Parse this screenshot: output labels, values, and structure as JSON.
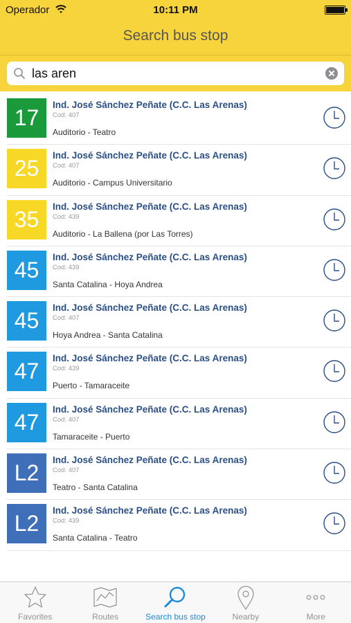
{
  "status_bar": {
    "carrier": "Operador",
    "time": "10:11 PM"
  },
  "nav": {
    "title": "Search bus stop"
  },
  "search": {
    "value": "las aren"
  },
  "colors": {
    "bar_yellow": "#f7d33c",
    "green": "#1a9a3a",
    "yellow": "#f7d826",
    "blue": "#1f9ae0",
    "dark_blue": "#3f6fb8",
    "active_tab": "#1a8bd9"
  },
  "results": [
    {
      "route": "17",
      "color": "#1a9a3a",
      "name": "Ind. José Sánchez Peñate (C.C. Las Arenas)",
      "code": "Cod: 407",
      "direction": "Auditorio - Teatro"
    },
    {
      "route": "25",
      "color": "#f7d826",
      "name": "Ind. José Sánchez Peñate (C.C. Las Arenas)",
      "code": "Cod: 407",
      "direction": "Auditorio - Campus Universitario"
    },
    {
      "route": "35",
      "color": "#f7d826",
      "name": "Ind. José Sánchez Peñate (C.C. Las Arenas)",
      "code": "Cod: 439",
      "direction": "Auditorio - La Ballena (por Las Torres)"
    },
    {
      "route": "45",
      "color": "#1f9ae0",
      "name": "Ind. José Sánchez Peñate (C.C. Las Arenas)",
      "code": "Cod: 439",
      "direction": "Santa Catalina - Hoya Andrea"
    },
    {
      "route": "45",
      "color": "#1f9ae0",
      "name": "Ind. José Sánchez Peñate (C.C. Las Arenas)",
      "code": "Cod: 407",
      "direction": "Hoya Andrea - Santa Catalina"
    },
    {
      "route": "47",
      "color": "#1f9ae0",
      "name": "Ind. José Sánchez Peñate (C.C. Las Arenas)",
      "code": "Cod: 439",
      "direction": "Puerto - Tamaraceite"
    },
    {
      "route": "47",
      "color": "#1f9ae0",
      "name": "Ind. José Sánchez Peñate (C.C. Las Arenas)",
      "code": "Cod: 407",
      "direction": "Tamaraceite - Puerto"
    },
    {
      "route": "L2",
      "color": "#3f6fb8",
      "name": "Ind. José Sánchez Peñate (C.C. Las Arenas)",
      "code": "Cod: 407",
      "direction": "Teatro - Santa Catalina"
    },
    {
      "route": "L2",
      "color": "#3f6fb8",
      "name": "Ind. José Sánchez Peñate (C.C. Las Arenas)",
      "code": "Cod: 439",
      "direction": "Santa Catalina - Teatro"
    }
  ],
  "tabs": [
    {
      "label": "Favorites",
      "icon": "star-icon"
    },
    {
      "label": "Routes",
      "icon": "map-icon"
    },
    {
      "label": "Search bus stop",
      "icon": "search-icon"
    },
    {
      "label": "Nearby",
      "icon": "location-pin-icon"
    },
    {
      "label": "More",
      "icon": "more-icon"
    }
  ]
}
